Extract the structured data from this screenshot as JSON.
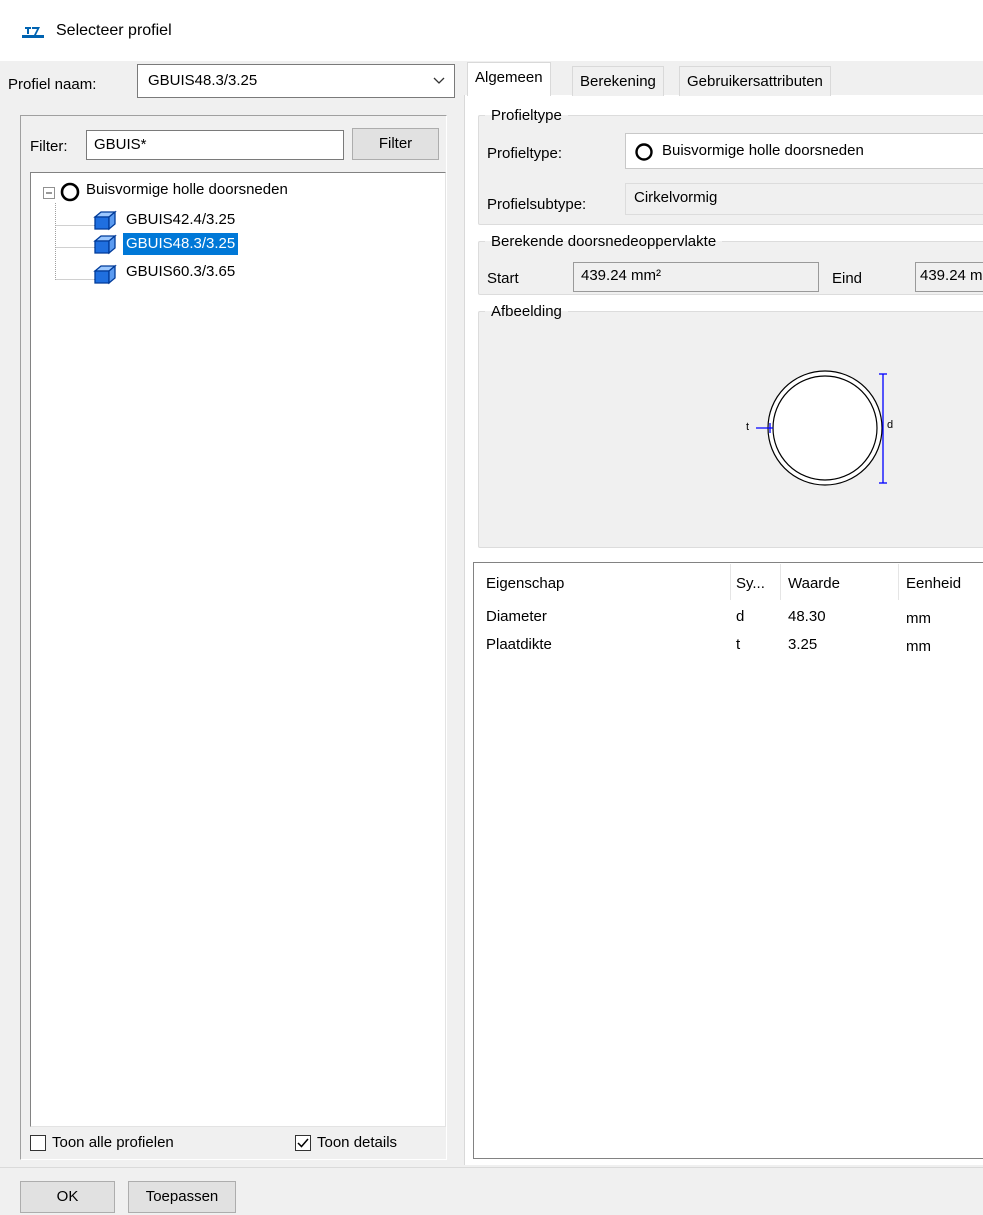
{
  "window": {
    "title": "Selecteer profiel",
    "icon": "app-logo-icon"
  },
  "profile_name": {
    "label": "Profiel naam:",
    "value": "GBUIS48.3/3.25"
  },
  "filter": {
    "label": "Filter:",
    "value": "GBUIS*",
    "button_label": "Filter"
  },
  "tree": {
    "root": {
      "label": "Buisvormige holle doorsneden",
      "icon": "circle-profile-icon",
      "expanded": true
    },
    "items": [
      {
        "label": "GBUIS42.4/3.25",
        "icon": "profile-shape-icon",
        "selected": false
      },
      {
        "label": "GBUIS48.3/3.25",
        "icon": "profile-shape-icon",
        "selected": true
      },
      {
        "label": "GBUIS60.3/3.65",
        "icon": "profile-shape-icon",
        "selected": false
      }
    ]
  },
  "options": {
    "show_all_label": "Toon alle profielen",
    "show_all_checked": false,
    "show_details_label": "Toon details",
    "show_details_checked": true
  },
  "tabs": [
    "Algemeen",
    "Berekening",
    "Gebruikersattributen"
  ],
  "active_tab": "Algemeen",
  "profieltype_group": {
    "legend": "Profieltype",
    "type_label": "Profieltype:",
    "type_value": "Buisvormige holle doorsneden",
    "subtype_label": "Profielsubtype:",
    "subtype_value": "Cirkelvormig"
  },
  "area_group": {
    "legend": "Berekende doorsnedeoppervlakte",
    "start_label": "Start",
    "start_value": "439.24 mm²",
    "end_label": "Eind",
    "end_value": "439.24 m"
  },
  "image_group": {
    "legend": "Afbeelding",
    "thickness_symbol": "t",
    "diameter_symbol": "d"
  },
  "properties": {
    "headers": [
      "Eigenschap",
      "Sy...",
      "Waarde",
      "Eenheid"
    ],
    "rows": [
      {
        "name": "Diameter",
        "symbol": "d",
        "value": "48.30",
        "unit": "mm"
      },
      {
        "name": "Plaatdikte",
        "symbol": "t",
        "value": "3.25",
        "unit": "mm"
      }
    ]
  },
  "buttons": {
    "ok": "OK",
    "apply": "Toepassen"
  },
  "colors": {
    "selection": "#0078d7",
    "accent": "#0063b1",
    "drawing_line": "#0000ff"
  }
}
